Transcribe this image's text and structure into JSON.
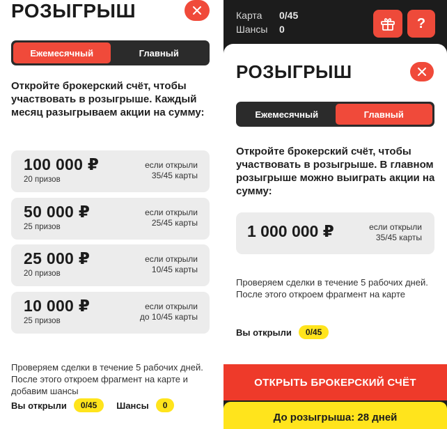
{
  "left": {
    "title": "РОЗЫГРЫШ",
    "tabs": [
      "Ежемесячный",
      "Главный"
    ],
    "active_tab": 0,
    "description": "Откройте брокерский счёт, чтобы участвовать в розыгрыше. Каждый месяц разыгрываем акции на сумму:",
    "prizes": [
      {
        "amount": "100 000 ₽",
        "count": "20 призов",
        "cond1": "если открыли",
        "cond2": "35/45 карты"
      },
      {
        "amount": "50 000 ₽",
        "count": "25 призов",
        "cond1": "если открыли",
        "cond2": "25/45 карты"
      },
      {
        "amount": "25 000 ₽",
        "count": "20 призов",
        "cond1": "если открыли",
        "cond2": "10/45 карты"
      },
      {
        "amount": "10 000 ₽",
        "count": "25 призов",
        "cond1": "если открыли",
        "cond2": "до 10/45 карты"
      }
    ],
    "note": "Проверяем сделки в течение 5 рабочих дней. После этого откроем фрагмент на карте и добавим шансы",
    "opened_label": "Вы открыли",
    "opened_value": "0/45",
    "chances_label": "Шансы",
    "chances_value": "0"
  },
  "right": {
    "header": {
      "card_label": "Карта",
      "card_value": "0/45",
      "chances_label": "Шансы",
      "chances_value": "0",
      "help_label": "?"
    },
    "title": "РОЗЫГРЫШ",
    "tabs": [
      "Ежемесячный",
      "Главный"
    ],
    "active_tab": 1,
    "description": "Откройте брокерский счёт, чтобы участвовать в розыгрыше. В главном розыгрыше можно выиграть акции на сумму:",
    "grand_prize": {
      "amount": "1 000 000 ₽",
      "cond1": "если открыли",
      "cond2": "35/45 карты"
    },
    "note": "Проверяем сделки в течение 5 рабочих дней. После этого откроем фрагмент на карте",
    "opened_label": "Вы открыли",
    "opened_value": "0/45",
    "cta_label": "ОТКРЫТЬ БРОКЕРСКИЙ СЧЁТ",
    "countdown": "До розыгрыша: 28 дней"
  },
  "colors": {
    "accent": "#ee3a2a",
    "highlight": "#ffe41c",
    "dark": "#1c1c1c"
  }
}
